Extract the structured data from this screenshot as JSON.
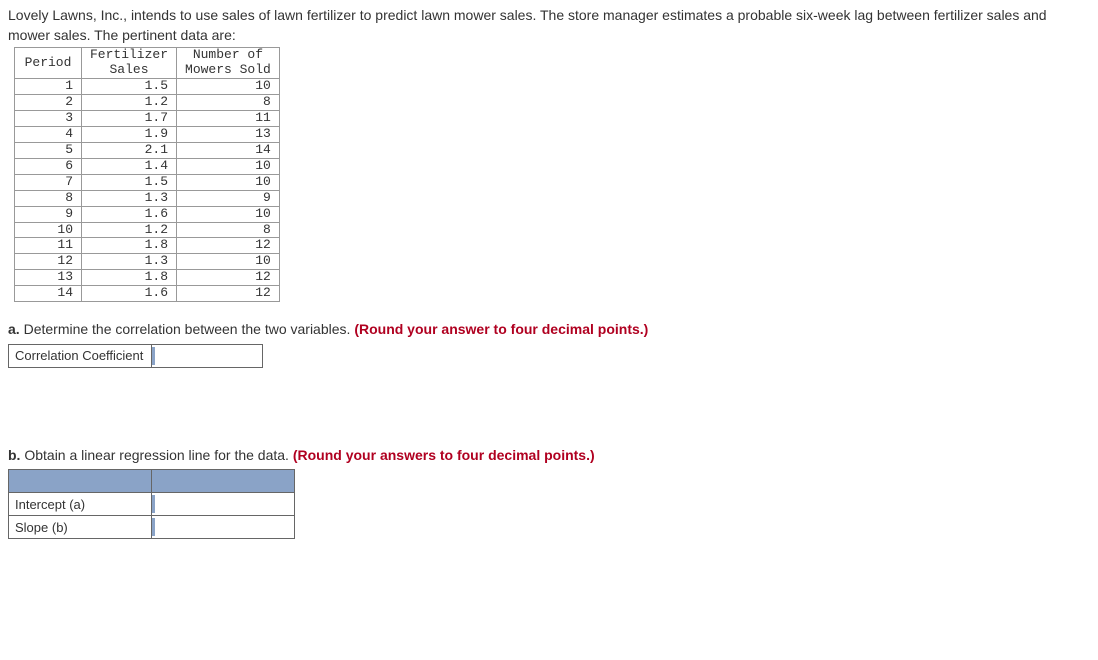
{
  "intro": "Lovely Lawns, Inc., intends to use sales of lawn fertilizer to predict lawn mower sales. The store manager estimates a probable six-week lag between fertilizer sales and mower sales. The pertinent data are:",
  "table": {
    "headers": {
      "period": "Period",
      "fertilizer": "Fertilizer\nSales",
      "mowers": "Number of\nMowers Sold"
    },
    "rows": [
      {
        "period": "1",
        "fertilizer": "1.5",
        "mowers": "10"
      },
      {
        "period": "2",
        "fertilizer": "1.2",
        "mowers": "8"
      },
      {
        "period": "3",
        "fertilizer": "1.7",
        "mowers": "11"
      },
      {
        "period": "4",
        "fertilizer": "1.9",
        "mowers": "13"
      },
      {
        "period": "5",
        "fertilizer": "2.1",
        "mowers": "14"
      },
      {
        "period": "6",
        "fertilizer": "1.4",
        "mowers": "10"
      },
      {
        "period": "7",
        "fertilizer": "1.5",
        "mowers": "10"
      },
      {
        "period": "8",
        "fertilizer": "1.3",
        "mowers": "9"
      },
      {
        "period": "9",
        "fertilizer": "1.6",
        "mowers": "10"
      },
      {
        "period": "10",
        "fertilizer": "1.2",
        "mowers": "8"
      },
      {
        "period": "11",
        "fertilizer": "1.8",
        "mowers": "12"
      },
      {
        "period": "12",
        "fertilizer": "1.3",
        "mowers": "10"
      },
      {
        "period": "13",
        "fertilizer": "1.8",
        "mowers": "12"
      },
      {
        "period": "14",
        "fertilizer": "1.6",
        "mowers": "12"
      }
    ]
  },
  "qa": {
    "prefix": "a. ",
    "text": "Determine the correlation between the two variables. ",
    "hint": "(Round your answer to four decimal points.)",
    "row_label": "Correlation Coefficient"
  },
  "qb": {
    "prefix": "b. ",
    "text": "Obtain a linear regression line for the data. ",
    "hint": "(Round your answers to four decimal points.)",
    "row1_label": "Intercept (a)",
    "row2_label": "Slope (b)"
  }
}
